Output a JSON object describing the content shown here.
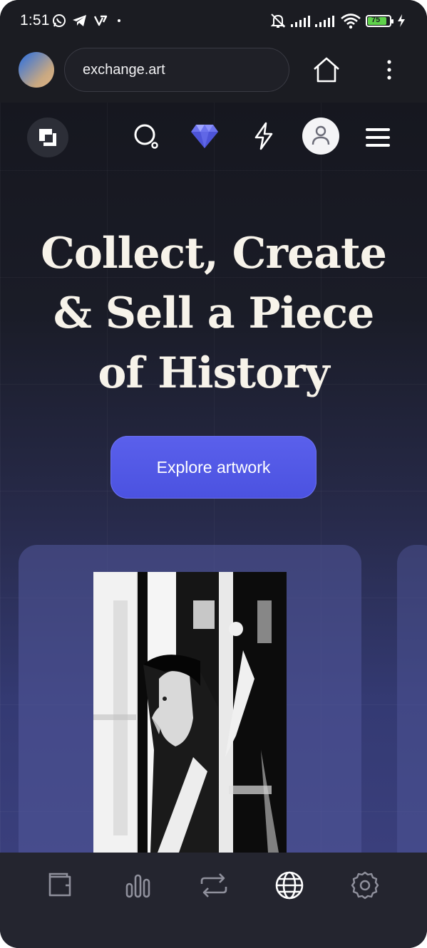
{
  "status_bar": {
    "time": "1:51",
    "battery": "75",
    "icons": [
      "whatsapp-icon",
      "telegram-icon",
      "vpn-icon",
      "dot-icon",
      "mute-icon",
      "signal-icon",
      "signal-icon",
      "wifi-icon",
      "battery-icon",
      "charging-icon"
    ]
  },
  "browser": {
    "url": "exchange.art",
    "icons": [
      "home-icon",
      "more-icon"
    ]
  },
  "nav": {
    "icons": [
      "logo-icon",
      "search-icon",
      "diamond-icon",
      "lightning-icon",
      "profile-icon",
      "hamburger-icon"
    ]
  },
  "hero": {
    "title_line1": "Collect, Create",
    "title_line2": "& Sell a Piece",
    "title_line3": "of History",
    "cta_label": "Explore artwork"
  },
  "bottom_nav": {
    "tabs": [
      "wallet-icon",
      "chart-icon",
      "swap-icon",
      "globe-icon",
      "settings-icon"
    ],
    "active": "globe-icon"
  },
  "colors": {
    "accent": "#5057e6",
    "background": "#1c1d25",
    "title": "#f7f3ea"
  }
}
